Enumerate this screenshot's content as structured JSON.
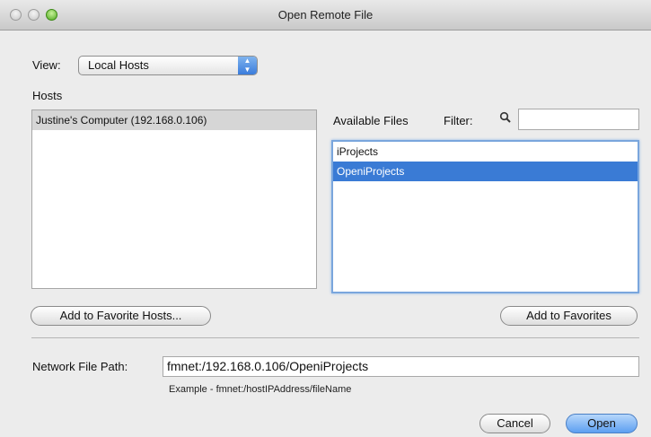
{
  "window": {
    "title": "Open Remote File"
  },
  "view": {
    "label": "View:",
    "selected": "Local Hosts"
  },
  "hosts": {
    "label": "Hosts",
    "items": [
      "Justine's Computer (192.168.0.106)"
    ]
  },
  "files": {
    "label": "Available Files",
    "filter_label": "Filter:",
    "filter_value": "",
    "items": [
      "iProjects",
      "OpeniProjects"
    ]
  },
  "buttons": {
    "add_favorite_hosts": "Add to Favorite Hosts...",
    "add_favorites": "Add to Favorites",
    "cancel": "Cancel",
    "open": "Open"
  },
  "network_path": {
    "label": "Network File Path:",
    "value": "fmnet:/192.168.0.106/OpeniProjects",
    "example": "Example - fmnet:/hostIPAddress/fileName"
  },
  "icons": {
    "filter": "search-icon",
    "select": "select-arrows-icon"
  },
  "colors": {
    "selection": "#3a7bd5",
    "default_button": "#5d9ff1",
    "zoom_button": "#4fa81f"
  }
}
